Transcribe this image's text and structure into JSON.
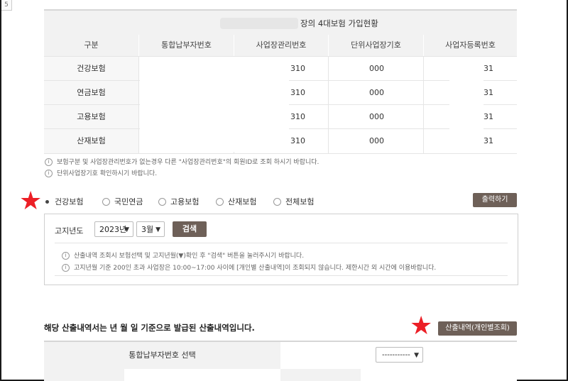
{
  "corner_label": "5",
  "top_table": {
    "title": "장의 4대보험 가입현황",
    "headers": [
      "구분",
      "통합납부자번호",
      "사업장관리번호",
      "단위사업장기호",
      "사업자등록번호"
    ],
    "rows": [
      {
        "label": "건강보험",
        "biz_no": "310",
        "unit_no": "000",
        "reg_no": "31"
      },
      {
        "label": "연금보험",
        "biz_no": "310",
        "unit_no": "000",
        "reg_no": "31"
      },
      {
        "label": "고용보험",
        "biz_no": "310",
        "unit_no": "000",
        "reg_no": "31"
      },
      {
        "label": "산재보험",
        "biz_no": "310",
        "unit_no": "000",
        "reg_no": "31"
      }
    ],
    "notes": [
      "보험구분 및 사업장관리번호가 없는경우 다른 \"사업장관리번호\"의 회원ID로 조회 하시기 바랍니다.",
      "단위사업장기호 확인하시기 바랍니다."
    ]
  },
  "insurance_options": [
    {
      "label": "건강보험",
      "selected": true
    },
    {
      "label": "국민연금",
      "selected": false
    },
    {
      "label": "고용보험",
      "selected": false
    },
    {
      "label": "산재보험",
      "selected": false
    },
    {
      "label": "전체보험",
      "selected": false
    }
  ],
  "print_button": "출력하기",
  "search": {
    "label": "고지년도",
    "year": "2023년",
    "month": "3월",
    "button": "검색",
    "notes": [
      "산출내역 조회시 보험선택 및 고지년월(▼)확인 후 \"검색\" 버튼을 눌러주시기 바랍니다.",
      "고지년월 기준 200인 초과 사업장은 10:00~17:00 사이에 [개인별 산출내역]이 조회되지 않습니다. 제한시간 외 시간에 이용바랍니다."
    ]
  },
  "bottom": {
    "title": "해당 산출내역서는 년 월 일 기준으로 발급된 산출내역입니다.",
    "detail_button": "산출내역(개인별조회)",
    "select_label": "통합납부자번호 선택",
    "select_value": "-----------"
  },
  "colors": {
    "accent_button": "#6e6058",
    "star": "#ec1f26"
  }
}
